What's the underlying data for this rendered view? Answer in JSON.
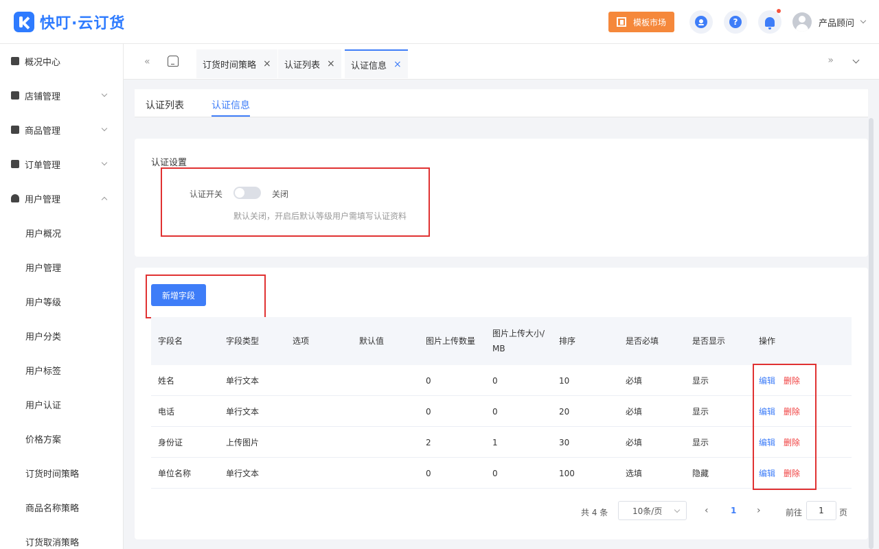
{
  "header": {
    "logo_text": "快叮·云订货",
    "market_label": "模板市场",
    "help_glyph": "?",
    "user_name": "产品顾问"
  },
  "sidebar": {
    "items": [
      {
        "label": "概况中心"
      },
      {
        "label": "店铺管理"
      },
      {
        "label": "商品管理"
      },
      {
        "label": "订单管理"
      },
      {
        "label": "用户管理"
      }
    ],
    "user_sub_items": [
      {
        "label": "用户概况"
      },
      {
        "label": "用户管理"
      },
      {
        "label": "用户等级"
      },
      {
        "label": "用户分类"
      },
      {
        "label": "用户标签"
      },
      {
        "label": "用户认证"
      },
      {
        "label": "价格方案"
      },
      {
        "label": "订货时间策略"
      },
      {
        "label": "商品名称策略"
      },
      {
        "label": "订货取消策略"
      }
    ]
  },
  "page_tabs": [
    {
      "label": "订货时间策略"
    },
    {
      "label": "认证列表"
    },
    {
      "label": "认证信息"
    }
  ],
  "sub_tabs": [
    {
      "label": "认证列表"
    },
    {
      "label": "认证信息"
    }
  ],
  "auth_settings": {
    "title": "认证设置",
    "switch_label": "认证开关",
    "switch_state": "关闭",
    "switch_on": false,
    "hint": "默认关闭，开启后默认等级用户需填写认证资料"
  },
  "fields": {
    "add_button": "新增字段",
    "headers": [
      "字段名",
      "字段类型",
      "选项",
      "默认值",
      "图片上传数量",
      "图片上传大小/MB",
      "排序",
      "是否必填",
      "是否显示",
      "操作"
    ],
    "rows": [
      {
        "name": "姓名",
        "type": "单行文本",
        "options": "",
        "default": "",
        "img_count": "0",
        "img_size": "0",
        "sort": "10",
        "required": "必填",
        "visible": "显示"
      },
      {
        "name": "电话",
        "type": "单行文本",
        "options": "",
        "default": "",
        "img_count": "0",
        "img_size": "0",
        "sort": "20",
        "required": "必填",
        "visible": "显示"
      },
      {
        "name": "身份证",
        "type": "上传图片",
        "options": "",
        "default": "",
        "img_count": "2",
        "img_size": "1",
        "sort": "30",
        "required": "必填",
        "visible": "显示"
      },
      {
        "name": "单位名称",
        "type": "单行文本",
        "options": "",
        "default": "",
        "img_count": "0",
        "img_size": "0",
        "sort": "100",
        "required": "选填",
        "visible": "隐藏"
      }
    ],
    "edit_label": "编辑",
    "delete_label": "删除"
  },
  "pagination": {
    "total_text": "共 4 条",
    "page_size": "10条/页",
    "current_page": "1",
    "goto_label": "前往",
    "goto_value": "1",
    "page_suffix": "页"
  },
  "colors": {
    "primary": "#3e7df8",
    "danger": "#f04040",
    "highlight": "#e03131",
    "market": "#f5883b"
  }
}
